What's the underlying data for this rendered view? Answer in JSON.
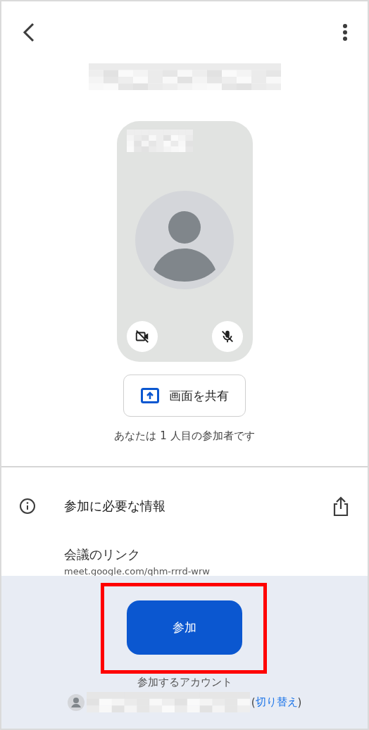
{
  "share_button": {
    "label": "画面を共有"
  },
  "participant_note": "あなたは 1 人目の参加者です",
  "info_section": {
    "title": "参加に必要な情報",
    "link_label": "会議のリンク",
    "link_value": "meet.google.com/qhm-rrrd-wrw"
  },
  "join_button": {
    "label": "参加"
  },
  "account": {
    "label": "参加するアカウント",
    "switch_open": "(",
    "switch_link": "切り替え",
    "switch_close": ")"
  }
}
